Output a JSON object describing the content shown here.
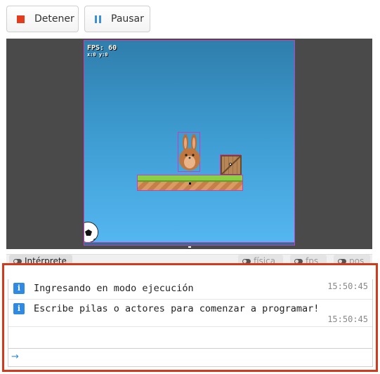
{
  "toolbar": {
    "stop_label": "Detener",
    "pause_label": "Pausar"
  },
  "game": {
    "fps_label": "FPS: 60",
    "sub_label": "x:0 y:0"
  },
  "tabs": {
    "interprete": "Intérprete",
    "fisica": "física",
    "fps": "fps",
    "pos": "pos"
  },
  "console": {
    "messages": [
      {
        "text": "Ingresando en modo ejecución",
        "time": "15:50:45"
      },
      {
        "text": "Escribe pilas o actores para comenzar a programar!",
        "time": "15:50:45"
      }
    ],
    "input_value": "",
    "prompt": "→"
  },
  "colors": {
    "stop": "#e23b1e",
    "pause": "#3d8fd8",
    "console_border": "#d23a1c",
    "info": "#2f8ae4"
  }
}
